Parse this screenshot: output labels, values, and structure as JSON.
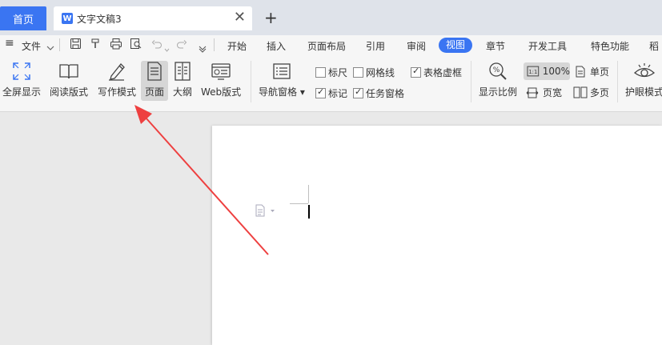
{
  "tabs": {
    "home_label": "首页",
    "doc_icon_letter": "W",
    "doc_label": "文字文稿3",
    "close_glyph": "✕",
    "new_tab_glyph": "+"
  },
  "menu": {
    "hamburger_glyph": "≡",
    "file_label": "文件",
    "items": [
      "开始",
      "插入",
      "页面布局",
      "引用",
      "审阅",
      "视图",
      "章节",
      "开发工具",
      "特色功能",
      "稻"
    ],
    "active": "视图"
  },
  "ribbon": {
    "fullscreen": "全屏显示",
    "reading": "阅读版式",
    "writing": "写作模式",
    "page": "页面",
    "outline": "大纲",
    "web": "Web版式",
    "nav_pane": "导航窗格",
    "ruler": "标尺",
    "gridlines": "网格线",
    "table_gridlines": "表格虚框",
    "marks": "标记",
    "task_pane": "任务窗格",
    "zoom": "显示比例",
    "zoom_value": "100%",
    "page_width": "页宽",
    "single_page": "单页",
    "multi_page": "多页",
    "eye_mode": "护眼模式"
  },
  "checkboxes": {
    "ruler": false,
    "gridlines": false,
    "table_gridlines": true,
    "marks": true,
    "task_pane": true
  },
  "colors": {
    "accent": "#3a75f2",
    "arrow": "#ee4040"
  }
}
